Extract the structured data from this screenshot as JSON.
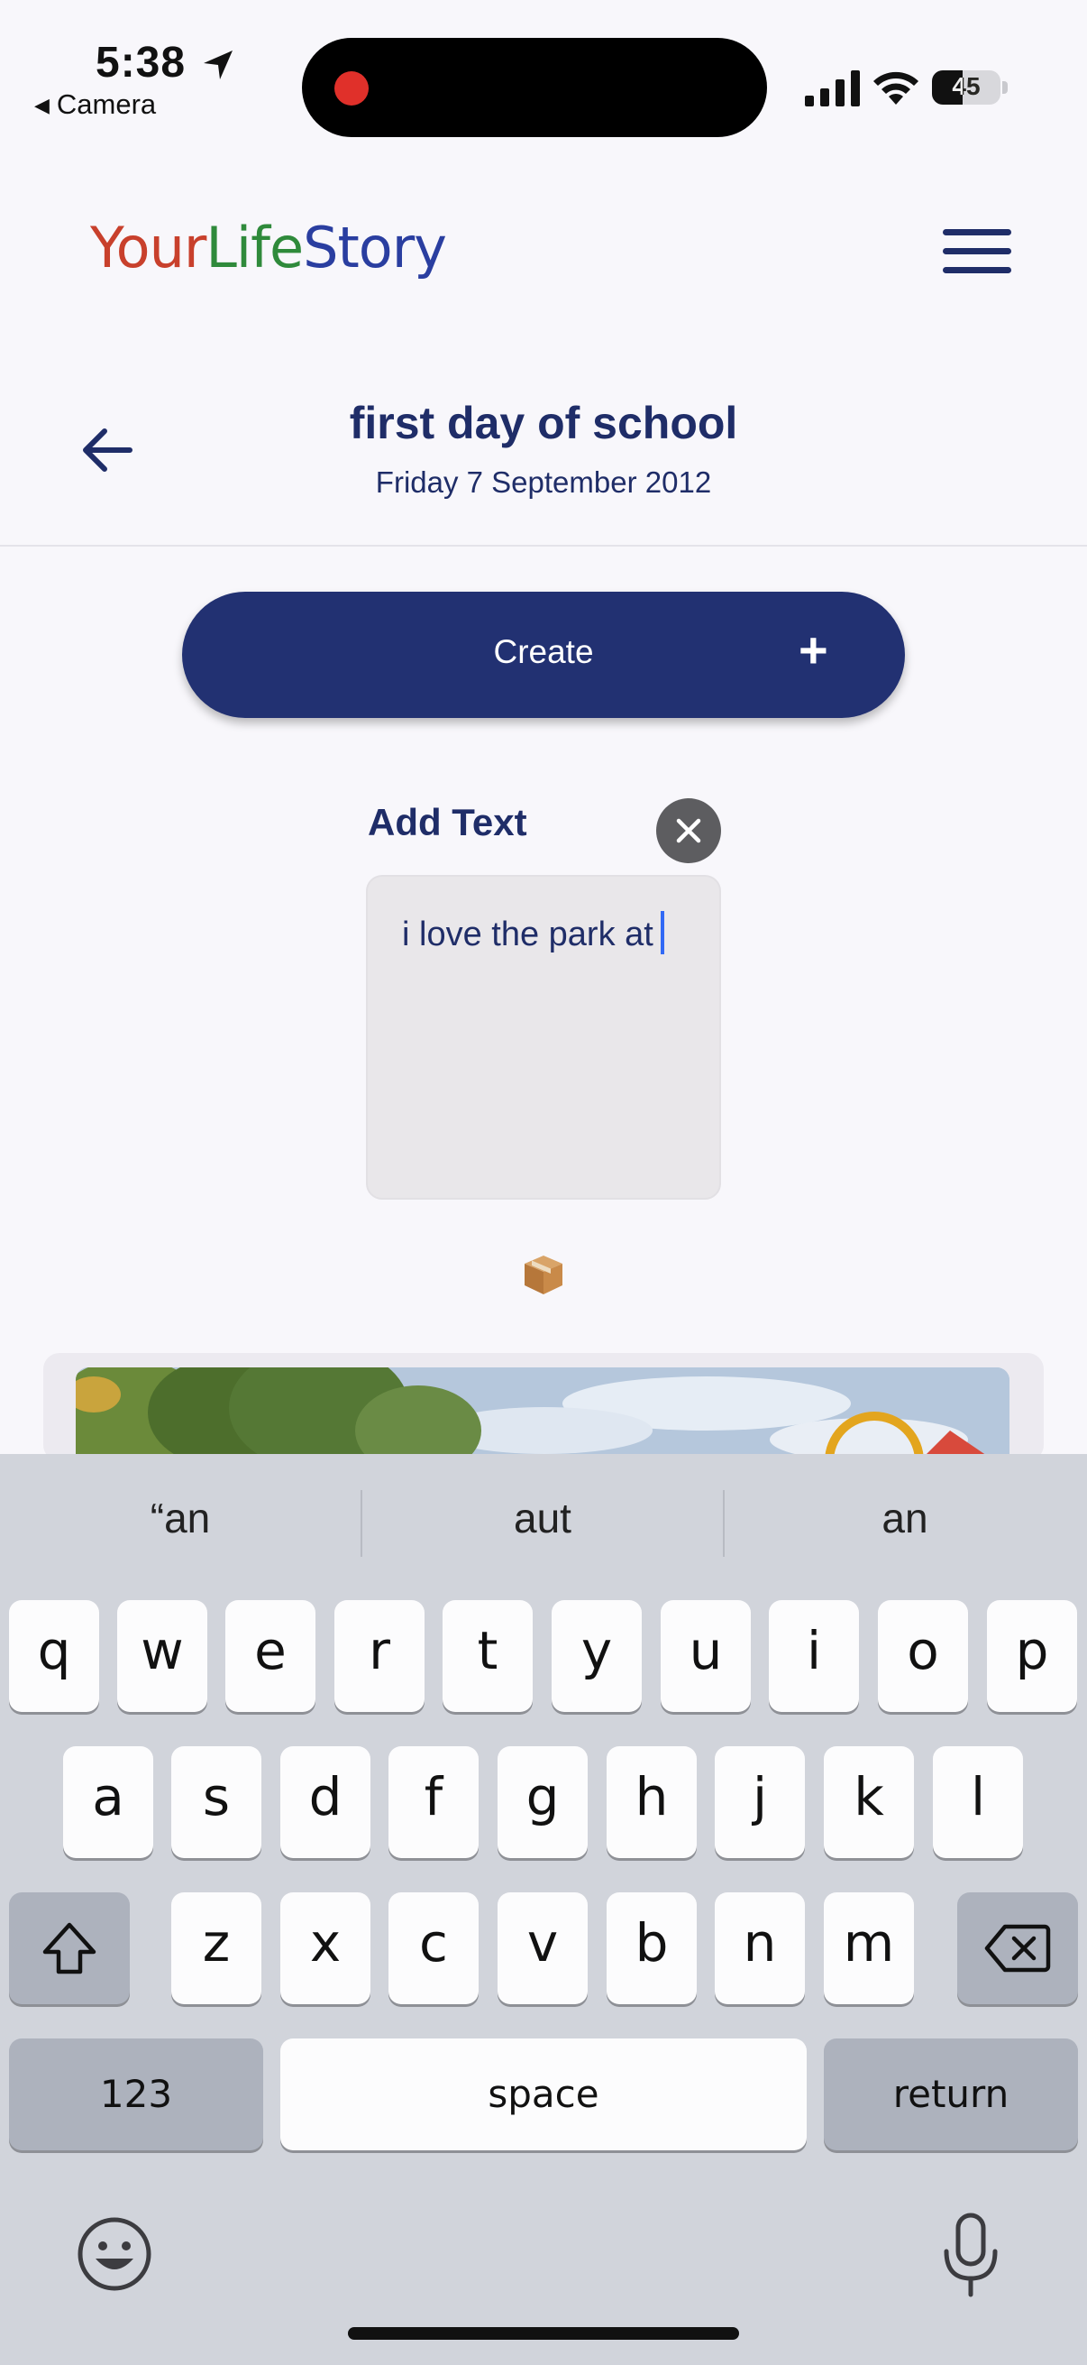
{
  "status_bar": {
    "time": "5:38",
    "back_app": "Camera",
    "battery": "45",
    "battery_level_percent": 45,
    "location_icon": "location-arrow-icon",
    "record_indicator_color": "#e0302a"
  },
  "header": {
    "logo": {
      "part1": "Your",
      "part2": "Life",
      "part3": "Story"
    },
    "logo_colors": [
      "#c8402c",
      "#2f8a3b",
      "#2a3ea0"
    ],
    "menu_icon": "hamburger-menu-icon"
  },
  "page": {
    "title": "first day of school",
    "date": "Friday 7 September 2012",
    "back_icon": "back-arrow-icon"
  },
  "actions": {
    "create_label": "Create",
    "create_icon_text": "+"
  },
  "editor": {
    "label": "Add Text",
    "value": "i love the park at",
    "close_icon": "close-icon"
  },
  "media": {
    "box_icon": "package-icon"
  },
  "keyboard": {
    "suggestions": [
      "“an",
      "aut",
      "an"
    ],
    "rows": [
      [
        "q",
        "w",
        "e",
        "r",
        "t",
        "y",
        "u",
        "i",
        "o",
        "p"
      ],
      [
        "a",
        "s",
        "d",
        "f",
        "g",
        "h",
        "j",
        "k",
        "l"
      ],
      [
        "z",
        "x",
        "c",
        "v",
        "b",
        "n",
        "m"
      ]
    ],
    "shift_icon": "shift-icon",
    "delete_icon": "backspace-icon",
    "numbers_label": "123",
    "space_label": "space",
    "return_label": "return",
    "emoji_icon": "emoji-icon",
    "mic_icon": "microphone-icon"
  },
  "colors": {
    "primary": "#223172",
    "text": "#1f2d68",
    "caret": "#3169f5",
    "background": "#f8f7fb"
  }
}
